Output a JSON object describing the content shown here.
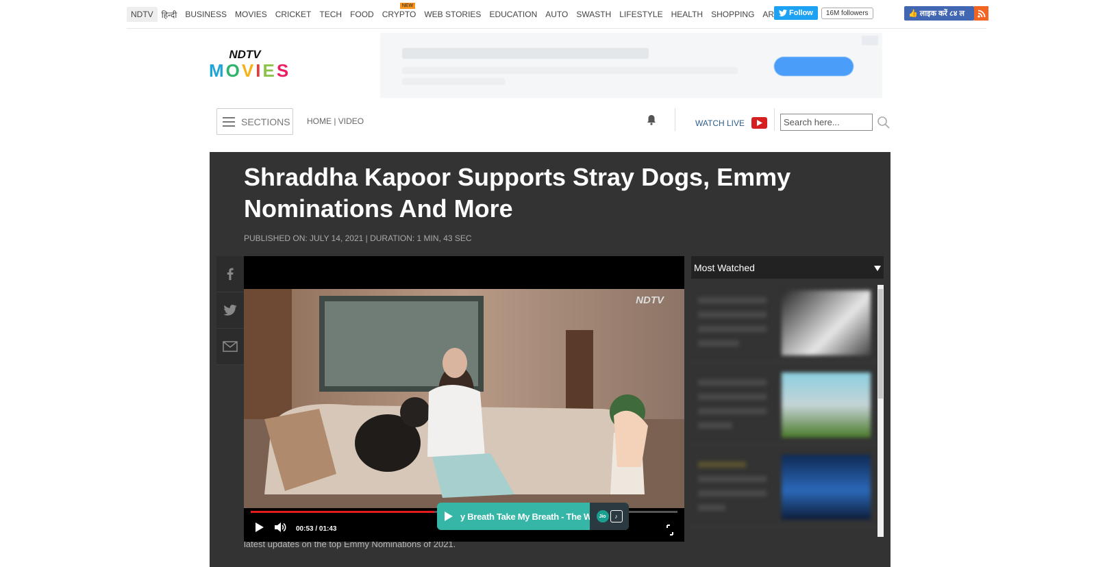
{
  "topnav": {
    "links": [
      {
        "label": "NDTV",
        "name": "nav-ndtv"
      },
      {
        "label": "हिन्दी",
        "name": "nav-hindi"
      },
      {
        "label": "BUSINESS",
        "name": "nav-business"
      },
      {
        "label": "MOVIES",
        "name": "nav-movies"
      },
      {
        "label": "CRICKET",
        "name": "nav-cricket"
      },
      {
        "label": "TECH",
        "name": "nav-tech"
      },
      {
        "label": "FOOD",
        "name": "nav-food"
      },
      {
        "label": "CRYPTO",
        "name": "nav-crypto",
        "badge": "NEW"
      },
      {
        "label": "WEB STORIES",
        "name": "nav-web-stories"
      },
      {
        "label": "EDUCATION",
        "name": "nav-education"
      },
      {
        "label": "AUTO",
        "name": "nav-auto"
      },
      {
        "label": "SWASTH",
        "name": "nav-swasth"
      },
      {
        "label": "LIFESTYLE",
        "name": "nav-lifestyle"
      },
      {
        "label": "HEALTH",
        "name": "nav-health"
      },
      {
        "label": "SHOPPING",
        "name": "nav-shopping"
      },
      {
        "label": "ART",
        "name": "nav-art"
      }
    ],
    "twitter": {
      "follow": "Follow",
      "followers": "16M followers"
    },
    "facebook": {
      "like": "लाइक करें ८४ ल"
    }
  },
  "logo": {
    "brand": "NDTV",
    "section": "MOVIES"
  },
  "toolbar": {
    "sections_label": "SECTIONS",
    "breadcrumb": "HOME | VIDEO",
    "watch_live": "WATCH LIVE",
    "search_placeholder": "Search here..."
  },
  "article": {
    "title": "Shraddha Kapoor Supports Stray Dogs, Emmy Nominations And More",
    "meta": "PUBLISHED ON: JULY 14, 2021 | DURATION: 1 MIN, 43 SEC",
    "caption": "latest updates on the top Emmy Nominations of 2021."
  },
  "player": {
    "watermark": "NDTV",
    "time": "00:53 / 01:43",
    "progress": 0.43,
    "toast_text": "y Breath    Take My Breath - The W",
    "jio": "Jio"
  },
  "most_watched": {
    "label": "Most Watched"
  },
  "colors": {
    "panel": "#333333",
    "accent_red": "#e21c1c",
    "twitter": "#1da1f2",
    "facebook": "#4267b2",
    "toast": "#35b6a6"
  }
}
